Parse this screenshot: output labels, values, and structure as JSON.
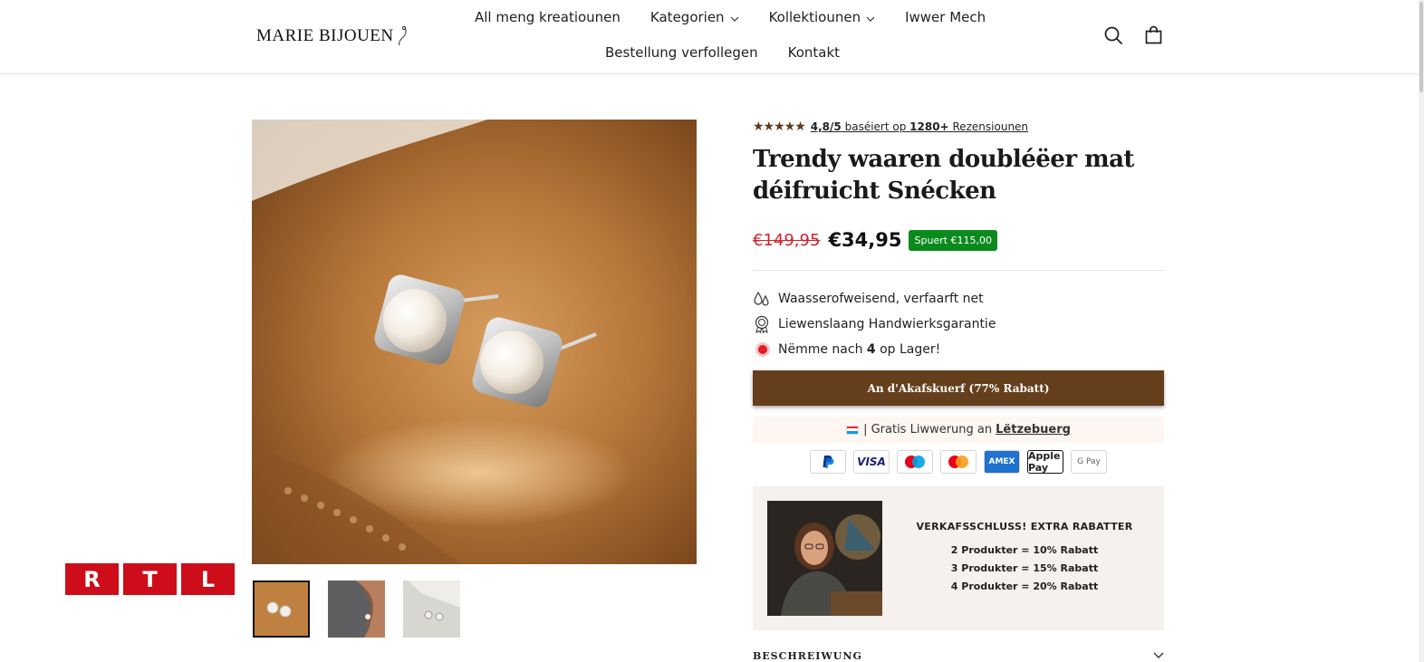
{
  "header": {
    "logo_text": "MARIE BIJOUEN",
    "nav_row1": [
      {
        "label": "All meng kreatiounen",
        "dropdown": false
      },
      {
        "label": "Kategorien",
        "dropdown": true
      },
      {
        "label": "Kollektiounen",
        "dropdown": true
      },
      {
        "label": "Iwwer Mech",
        "dropdown": false
      }
    ],
    "nav_row2": [
      {
        "label": "Bestellung verfollegen"
      },
      {
        "label": "Kontakt"
      }
    ],
    "icons": [
      "search-icon",
      "cart-icon"
    ]
  },
  "gallery": {
    "thumbs": [
      "earring-closeup",
      "ear-model",
      "earrings-with-card"
    ],
    "active_thumb": 0
  },
  "rtl_badge": [
    "R",
    "T",
    "L"
  ],
  "product": {
    "rating_value": "4,8/5",
    "rating_text": "baséiert op",
    "rating_count": "1280+",
    "rating_suffix": "Rezensiounen",
    "title": "Trendy waaren doubléëer mat déifruicht Snécken",
    "old_price": "€149,95",
    "new_price": "€34,95",
    "save_badge": "Spuert €115,00",
    "features": [
      {
        "icon": "water-drops-icon",
        "text": "Waasserofweisend, verfaarft net"
      },
      {
        "icon": "award-ribbon-icon",
        "text": "Liewenslaang Handwierksgarantie"
      }
    ],
    "stock_prefix": "Nëmme nach",
    "stock_count": "4",
    "stock_suffix": "op Lager!",
    "cart_button": "An d'Akafskuerf (77% Rabatt)",
    "shipping_text": "| Gratis Liwwerung an",
    "shipping_country": "Lëtzebuerg",
    "payments": [
      "PayPal",
      "VISA",
      "Maestro",
      "Mastercard",
      "AMEX",
      "Apple Pay",
      "G Pay"
    ]
  },
  "promo": {
    "heading": "VERKAFSSCHLUSS! EXTRA RABATTER",
    "lines": [
      "2 Produkter = 10% Rabatt",
      "3 Produkter = 15% Rabatt",
      "4 Produkter = 20% Rabatt"
    ]
  },
  "description_label": "BESCHREIWUNG",
  "colors": {
    "brown_button": "#653f1c",
    "star_color": "#5b3a1d",
    "sale_red": "#d0202c",
    "badge_green": "#0a8a1c",
    "rtl_red": "#cd0d1a"
  }
}
